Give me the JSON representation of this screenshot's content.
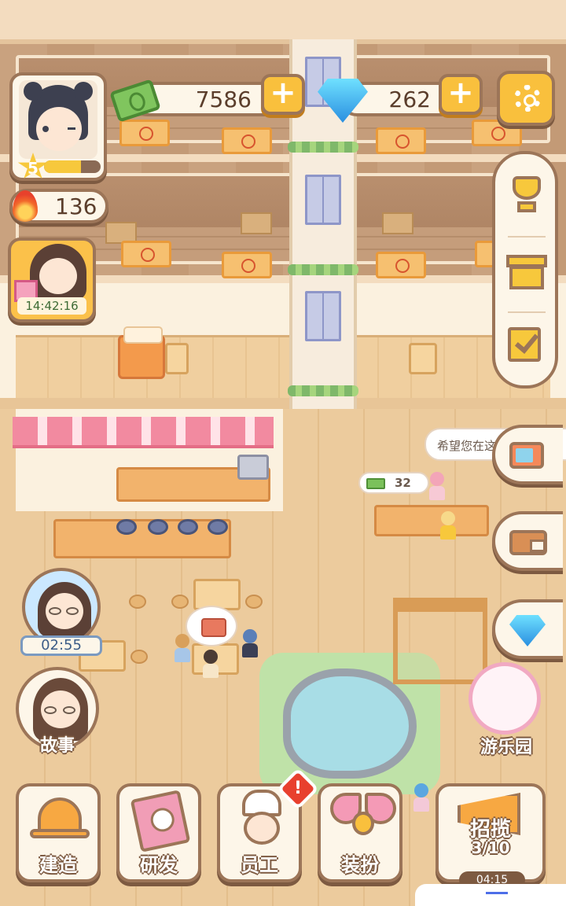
{
  "hud": {
    "player_level": "5",
    "xp_fraction": 0.65,
    "cash": "7586",
    "gems": "262",
    "energy": "136",
    "plus_label": "+"
  },
  "offer": {
    "timer": "14:42:16"
  },
  "event": {
    "timer": "02:55"
  },
  "scene": {
    "speech_text": "希望您在这",
    "income_amount": "32"
  },
  "buttons": {
    "story": "故事",
    "amusement_park": "游乐园",
    "build": "建造",
    "research": "研发",
    "staff": "员工",
    "dressup": "装扮",
    "recruit": "招揽",
    "recruit_progress": "3/10",
    "recruit_timer": "04:15",
    "staff_alert": "!"
  },
  "icons": {
    "settings": "gear-icon",
    "trophy": "trophy-icon",
    "gift": "gift-icon",
    "tasks": "checklist-icon",
    "tv": "tv-icon",
    "wallet": "wallet-icon",
    "diamond": "diamond-icon",
    "cash": "cash-icon",
    "energy": "flame-icon"
  },
  "colors": {
    "frame": "#9c7558",
    "accent": "#f9c03d",
    "panel": "#fdf6e9"
  }
}
